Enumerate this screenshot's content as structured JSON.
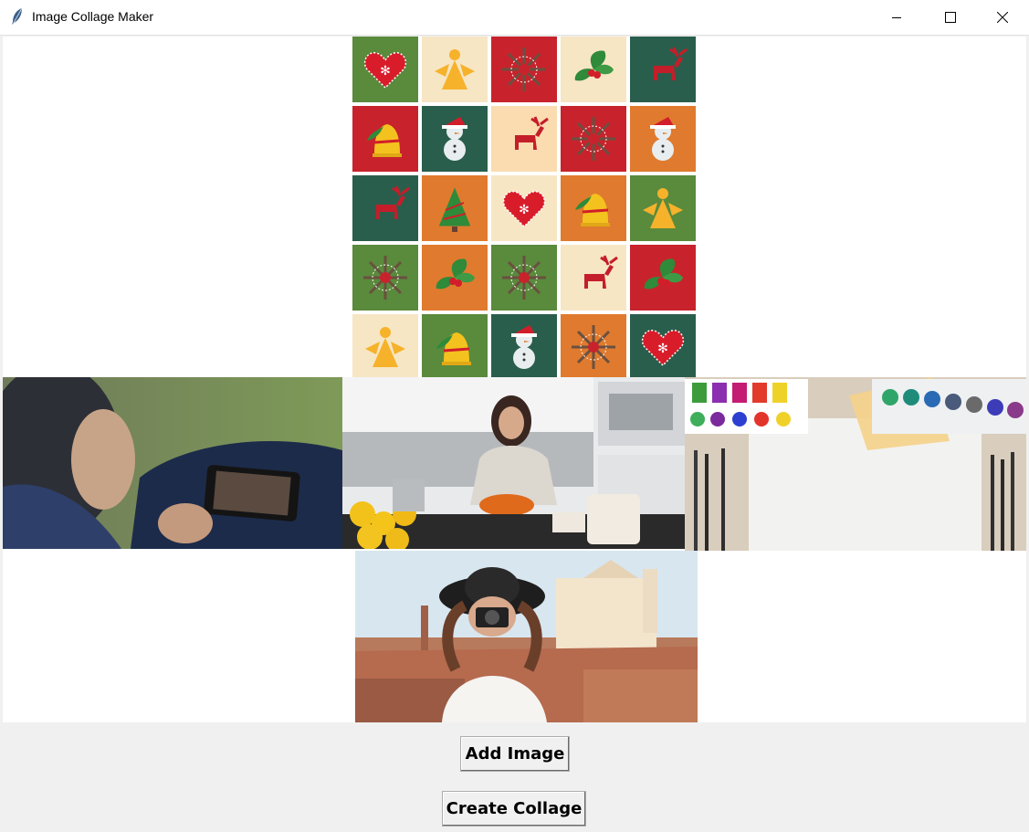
{
  "window": {
    "title": "Image Collage Maker",
    "app_icon": "feather-icon",
    "controls": [
      "minimize-icon",
      "maximize-icon",
      "close-icon"
    ]
  },
  "collage": {
    "grid_rows": 5,
    "grid_cols": 5,
    "tiles": [
      [
        "heart",
        "angel",
        "snowflake",
        "holly",
        "reindeer"
      ],
      [
        "bell",
        "snowman",
        "reindeer",
        "snowflake",
        "snowman"
      ],
      [
        "reindeer",
        "tree",
        "heart",
        "bell",
        "angel"
      ],
      [
        "snowflake",
        "holly",
        "snowflake",
        "reindeer",
        "holly"
      ],
      [
        "angel",
        "bell",
        "snowman",
        "snowflake",
        "heart"
      ]
    ],
    "photos": [
      "person-watching-phone-photo",
      "woman-cooking-kitchen-photo",
      "watercolor-paints-paper-photo",
      "woman-with-camera-photo"
    ]
  },
  "buttons": {
    "add_image": "Add Image",
    "create_collage": "Create Collage"
  },
  "colors": {
    "tile_red": "#c8232c",
    "tile_green": "#5a8a3c",
    "tile_dark_green": "#2a5e4c",
    "tile_cream": "#f7e6c4",
    "tile_orange": "#e07a2e",
    "tile_peach": "#fadcb0"
  }
}
